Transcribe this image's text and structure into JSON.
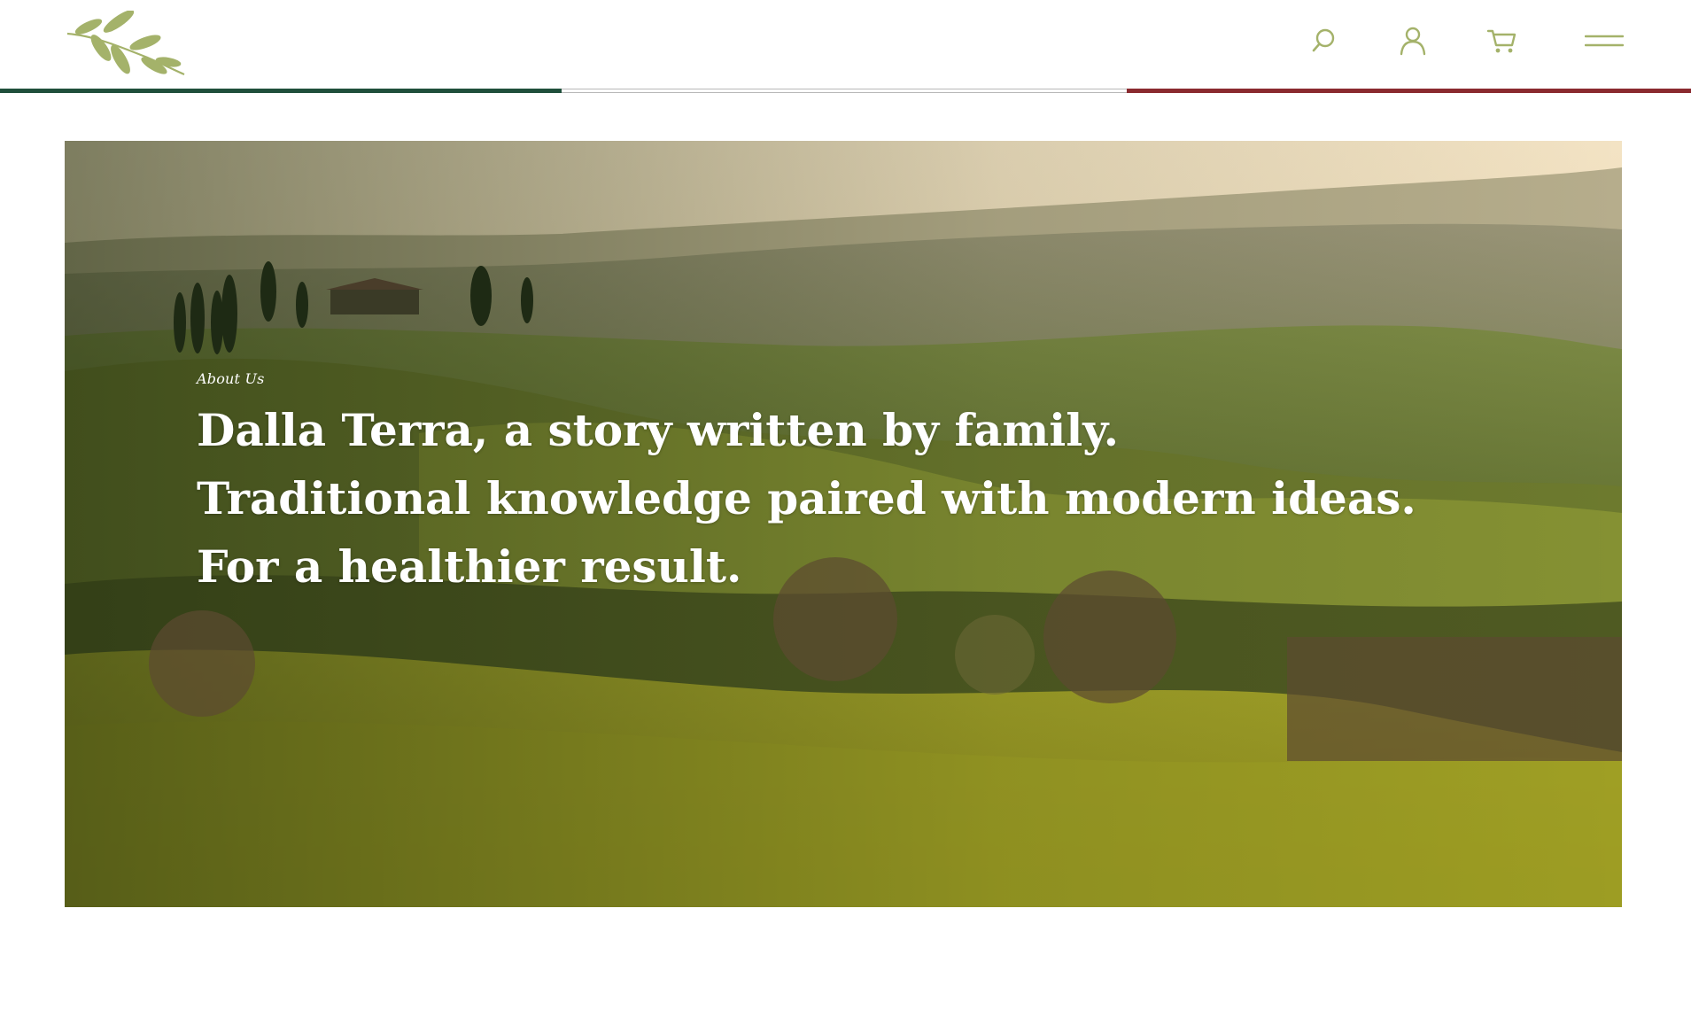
{
  "brand": {
    "logo_icon": "olive-branch-icon",
    "accent_color": "#a4b26a"
  },
  "header": {
    "actions": [
      {
        "name": "search",
        "icon": "search-icon"
      },
      {
        "name": "account",
        "icon": "user-icon"
      },
      {
        "name": "cart",
        "icon": "cart-icon"
      },
      {
        "name": "menu",
        "icon": "hamburger-icon"
      }
    ]
  },
  "flag_colors": {
    "green": "#1f4f3b",
    "white": "#ffffff",
    "red": "#8a2a2f"
  },
  "hero": {
    "eyebrow": "About Us",
    "headline_lines": [
      "Dalla Terra, a story written by family.",
      "Traditional knowledge paired with modern ideas.",
      "For a healthier result."
    ]
  }
}
